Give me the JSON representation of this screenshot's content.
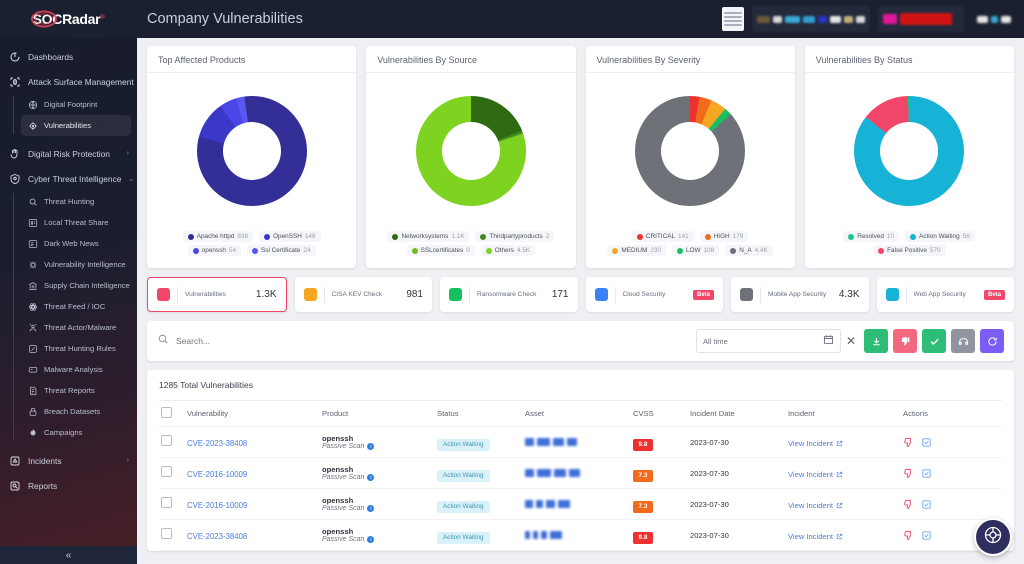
{
  "header": {
    "logo": "SOCRadar",
    "logo_sup": "®",
    "title": "Company Vulnerabilities"
  },
  "sidebar": {
    "collapse_icon": "«",
    "items": [
      {
        "label": "Dashboards",
        "icon": "dashboard-icon",
        "caret": ""
      },
      {
        "label": "Attack Surface Management",
        "icon": "target-icon",
        "caret": "⌄"
      },
      {
        "label": "Digital Risk Protection",
        "icon": "hand-shield-icon",
        "caret": "›"
      },
      {
        "label": "Cyber Threat Intelligence",
        "icon": "shield-icon",
        "caret": "⌄"
      },
      {
        "label": "Incidents",
        "icon": "alert-icon",
        "caret": "›"
      },
      {
        "label": "Reports",
        "icon": "report-icon",
        "caret": ""
      }
    ],
    "asm_sub": [
      {
        "label": "Digital Footprint",
        "icon": "globe-icon",
        "active": false
      },
      {
        "label": "Vulnerabilities",
        "icon": "bug-lock-icon",
        "active": true
      }
    ],
    "cti_sub": [
      {
        "label": "Threat Hunting",
        "icon": "search-icon"
      },
      {
        "label": "Local Threat Share",
        "icon": "share-icon"
      },
      {
        "label": "Dark Web News",
        "icon": "news-icon"
      },
      {
        "label": "Vulnerability Intelligence",
        "icon": "bug-icon"
      },
      {
        "label": "Supply Chain Intelligence",
        "icon": "bank-icon"
      },
      {
        "label": "Threat Feed / IOC",
        "icon": "feed-icon"
      },
      {
        "label": "Threat Actor/Malware",
        "icon": "actor-icon"
      },
      {
        "label": "Threat Hunting Rules",
        "icon": "rules-icon"
      },
      {
        "label": "Malware Analysis",
        "icon": "malware-icon"
      },
      {
        "label": "Threat Reports",
        "icon": "doc-icon"
      },
      {
        "label": "Breach Datasets",
        "icon": "lock-icon"
      },
      {
        "label": "Campaigns",
        "icon": "fire-icon"
      }
    ]
  },
  "chart_data": [
    {
      "type": "pie",
      "title": "Top Affected Products",
      "categories": [
        "Apache httpd",
        "OpenSSH",
        "openssh",
        "Ssl Certificate"
      ],
      "values": [
        838,
        148,
        54,
        24
      ],
      "value_labels": [
        "838",
        "148",
        "54",
        "24"
      ],
      "colors": [
        "#332f96",
        "#3b37c9",
        "#4b46e8",
        "#5a57f0"
      ],
      "legend": "bottom"
    },
    {
      "type": "pie",
      "title": "Vulnerabilities By Source",
      "categories": [
        "Networksystems",
        "Thirdpartyproducts",
        "SSLcertificates",
        "Others"
      ],
      "values": [
        1100,
        2,
        0,
        4500
      ],
      "value_labels": [
        "1.1K",
        "2",
        "0",
        "4.5K"
      ],
      "colors": [
        "#2f6b12",
        "#3f8a18",
        "#6fbf1f",
        "#7ed321"
      ],
      "legend": "bottom"
    },
    {
      "type": "pie",
      "title": "Vulnerabilities By Severity",
      "categories": [
        "CRITICAL",
        "HIGH",
        "MEDIUM",
        "LOW",
        "N_A"
      ],
      "values": [
        141,
        179,
        230,
        108,
        4400
      ],
      "value_labels": [
        "141",
        "179",
        "230",
        "108",
        "4.4K"
      ],
      "colors": [
        "#ed3030",
        "#f26a1b",
        "#f5a623",
        "#16c060",
        "#6e7178"
      ],
      "legend": "bottom"
    },
    {
      "type": "pie",
      "title": "Vulnerabilities By Status",
      "categories": [
        "Resolved",
        "Action Waiting",
        "False Positive"
      ],
      "values": [
        10,
        5000,
        570
      ],
      "value_labels": [
        "10",
        "5K",
        "570"
      ],
      "colors": [
        "#19c98a",
        "#17b3d6",
        "#f1456a"
      ],
      "legend": "bottom"
    }
  ],
  "stats": [
    {
      "label": "Vulnerabilities",
      "value": "1.3K",
      "color": "#f1456a",
      "selected": true,
      "beta": false
    },
    {
      "label": "CISA KEV Check",
      "value": "981",
      "color": "#f5a623",
      "selected": false,
      "beta": false
    },
    {
      "label": "Ransomware Check",
      "value": "171",
      "color": "#16c060",
      "selected": false,
      "beta": false
    },
    {
      "label": "Cloud Security",
      "value": "",
      "color": "#3b82f6",
      "selected": false,
      "beta": true,
      "beta_label": "Beta"
    },
    {
      "label": "Mobile App Security",
      "value": "4.3K",
      "color": "#6e7178",
      "selected": false,
      "beta": false
    },
    {
      "label": "Web App Security",
      "value": "",
      "color": "#17b3d6",
      "selected": false,
      "beta": true,
      "beta_label": "Beta"
    }
  ],
  "toolbar": {
    "search_placeholder": "Search...",
    "search_value": "",
    "date_filter": "All time",
    "buttons": [
      {
        "name": "export-button",
        "icon": "download-icon",
        "color": "#2dbd77"
      },
      {
        "name": "dislike-button",
        "icon": "thumbs-down-icon",
        "color": "#f1687f"
      },
      {
        "name": "approve-button",
        "icon": "check-icon",
        "color": "#2dbd77"
      },
      {
        "name": "mute-button",
        "icon": "mute-icon",
        "color": "#8f949e"
      },
      {
        "name": "refresh-button",
        "icon": "refresh-icon",
        "color": "#7c5cf5"
      }
    ]
  },
  "table": {
    "total_text": "1285 Total Vulnerabilities",
    "columns": [
      "Vulnerability",
      "Product",
      "Status",
      "Asset",
      "CVSS",
      "Incident Date",
      "Incident",
      "Actions"
    ],
    "rows": [
      {
        "vulnerability": "CVE-2023-38408",
        "product": "openssh",
        "scan": "Passive Scan",
        "status": "Action Waiting",
        "cvss": "9.8",
        "cvss_color": "#ed3030",
        "incident_date": "2023-07-30",
        "incident": "View Incident"
      },
      {
        "vulnerability": "CVE-2016-10009",
        "product": "openssh",
        "scan": "Passive Scan",
        "status": "Action Waiting",
        "cvss": "7.3",
        "cvss_color": "#f26a1b",
        "incident_date": "2023-07-30",
        "incident": "View Incident"
      },
      {
        "vulnerability": "CVE-2016-10009",
        "product": "openssh",
        "scan": "Passive Scan",
        "status": "Action Waiting",
        "cvss": "7.3",
        "cvss_color": "#f26a1b",
        "incident_date": "2023-07-30",
        "incident": "View Incident"
      },
      {
        "vulnerability": "CVE-2023-38408",
        "product": "openssh",
        "scan": "Passive Scan",
        "status": "Action Waiting",
        "cvss": "9.8",
        "cvss_color": "#ed3030",
        "incident_date": "2023-07-30",
        "incident": "View Incident"
      }
    ]
  },
  "fab": {
    "icon": "lifebuoy-icon"
  }
}
